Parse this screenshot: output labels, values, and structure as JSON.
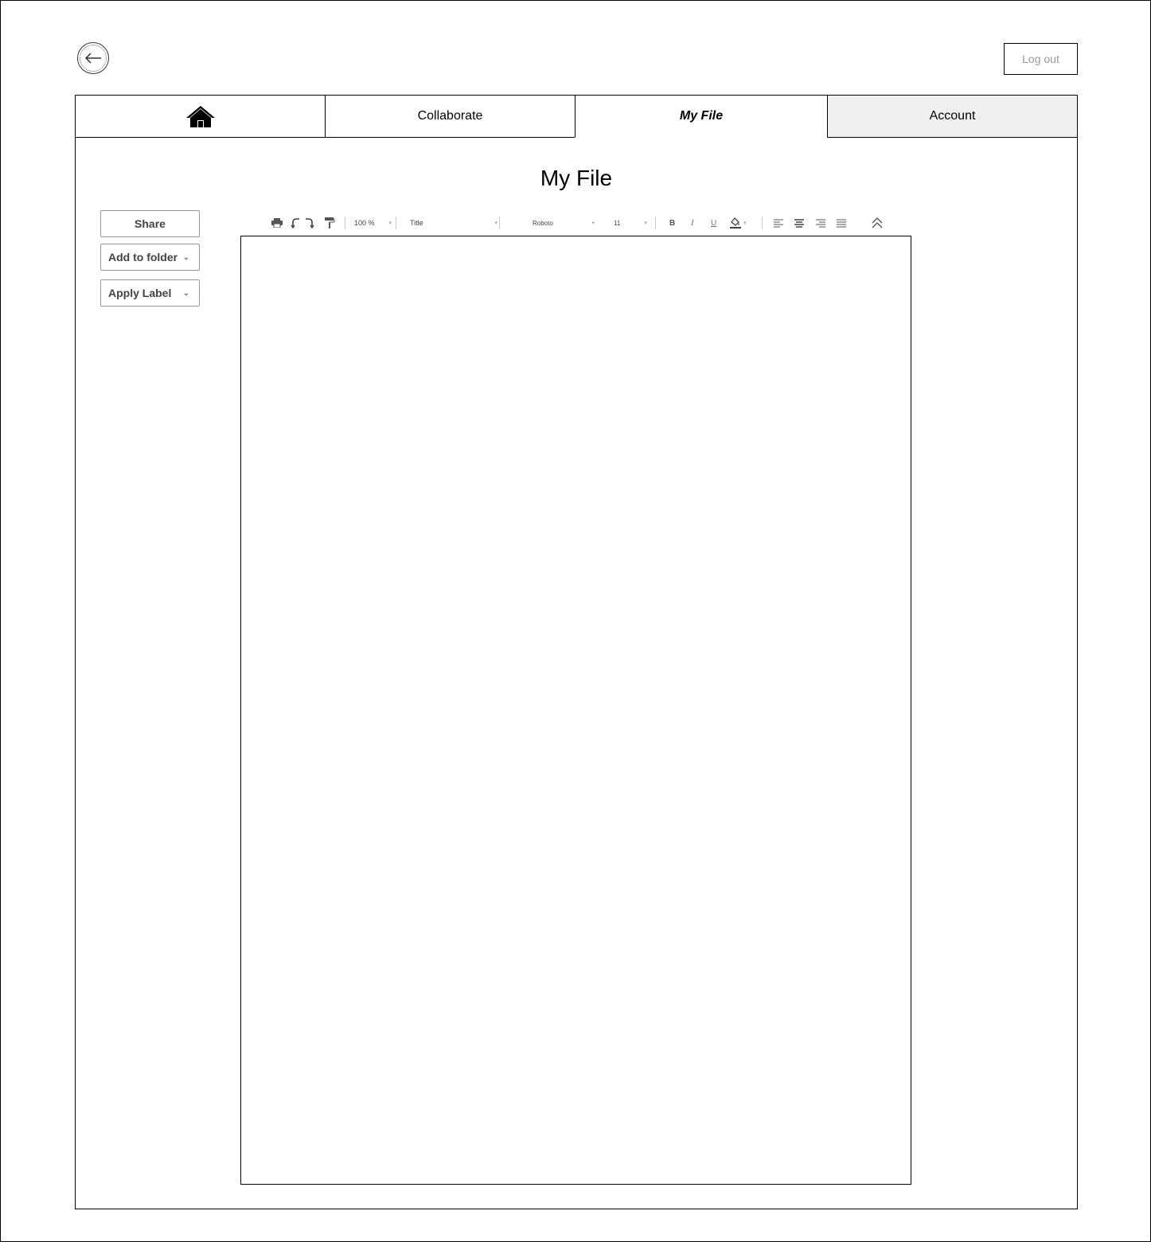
{
  "header": {
    "logout_label": "Log out"
  },
  "tabs": [
    {
      "label": "",
      "icon": "home-icon"
    },
    {
      "label": "Collaborate"
    },
    {
      "label": "My File",
      "active": true
    },
    {
      "label": "Account"
    }
  ],
  "page": {
    "title": "My File"
  },
  "sidebar": {
    "share_label": "Share",
    "add_to_folder_label": "Add to folder",
    "apply_label_label": "Apply Label"
  },
  "toolbar": {
    "zoom": "100 %",
    "style": "Title",
    "font": "Roboto",
    "size": "11",
    "bold": "B",
    "italic": "I",
    "underline": "U"
  },
  "colors": {
    "account_tab_bg": "#f0f0f0",
    "logout_text": "#999999"
  }
}
